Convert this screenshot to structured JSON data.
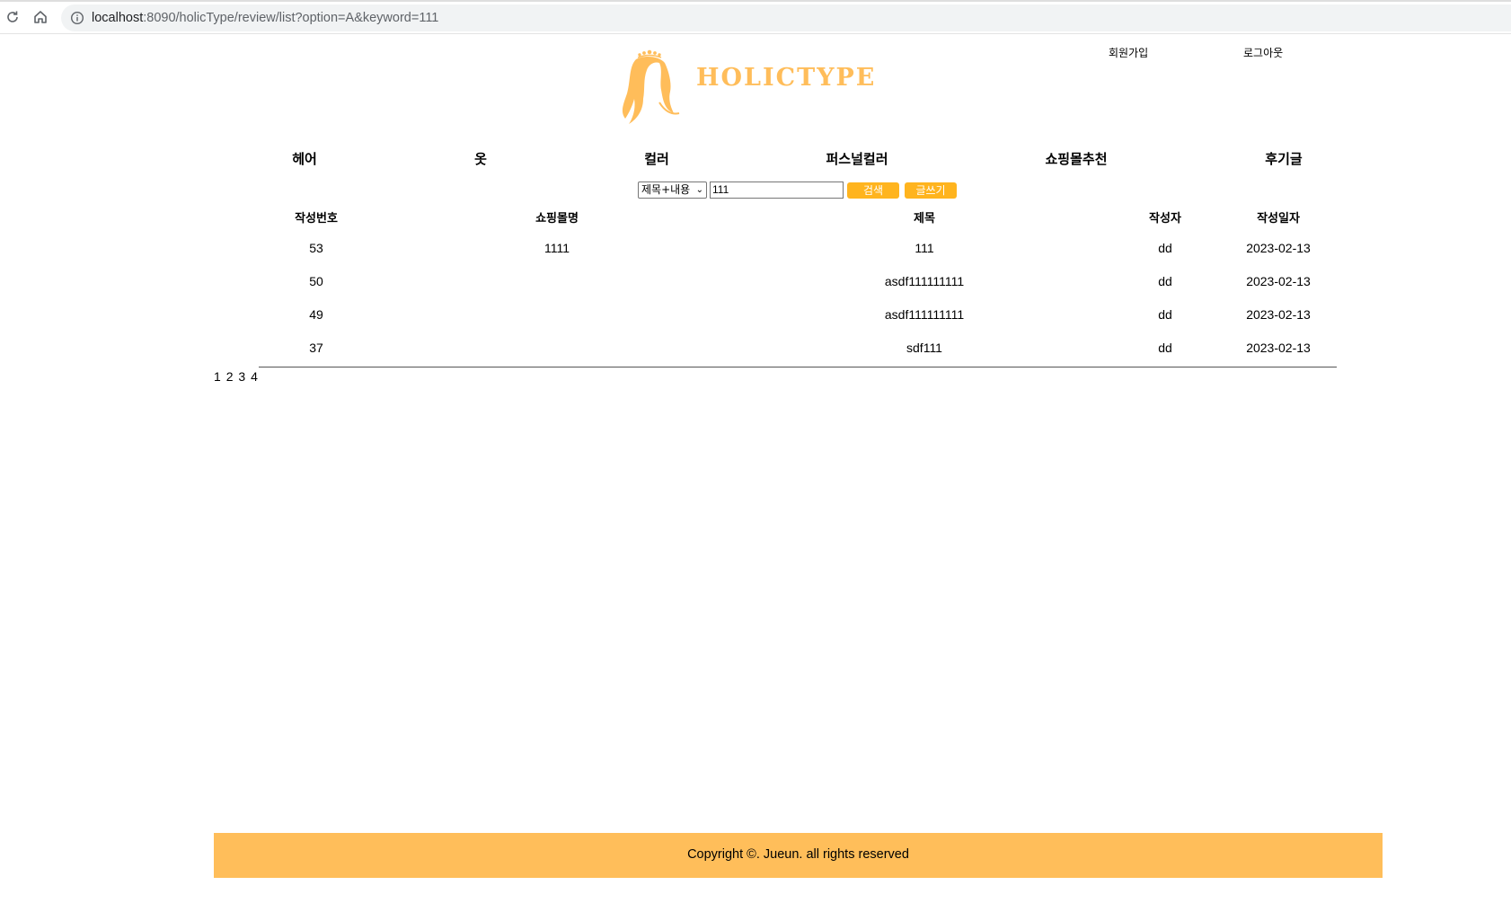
{
  "browser": {
    "url_host": "localhost",
    "url_rest": ":8090/holicType/review/list?option=A&keyword=111"
  },
  "header": {
    "signup_label": "회원가입",
    "logout_label": "로그아웃",
    "logo_text": "HOLICTYPE",
    "accent_color": "#ffbd5a"
  },
  "menu": {
    "items": [
      {
        "label": "헤어"
      },
      {
        "label": "옷"
      },
      {
        "label": "컬러"
      },
      {
        "label": "퍼스널컬러"
      },
      {
        "label": "쇼핑몰추천"
      },
      {
        "label": "후기글"
      }
    ]
  },
  "search": {
    "option_selected": "제목+내용",
    "keyword": "111",
    "search_label": "검색",
    "write_label": "글쓰기"
  },
  "table": {
    "headers": [
      "작성번호",
      "쇼핑몰명",
      "제목",
      "작성자",
      "작성일자"
    ],
    "rows": [
      [
        "53",
        "1111",
        "111",
        "dd",
        "2023-02-13"
      ],
      [
        "50",
        "",
        "asdf111111111",
        "dd",
        "2023-02-13"
      ],
      [
        "49",
        "",
        "asdf111111111",
        "dd",
        "2023-02-13"
      ],
      [
        "37",
        "",
        "sdf111",
        "dd",
        "2023-02-13"
      ]
    ]
  },
  "pager": {
    "pages": [
      "1",
      "2",
      "3",
      "4"
    ]
  },
  "footer": {
    "copyright": "Copyright ©. Jueun. all rights reserved",
    "color": "#ffbe5a"
  }
}
